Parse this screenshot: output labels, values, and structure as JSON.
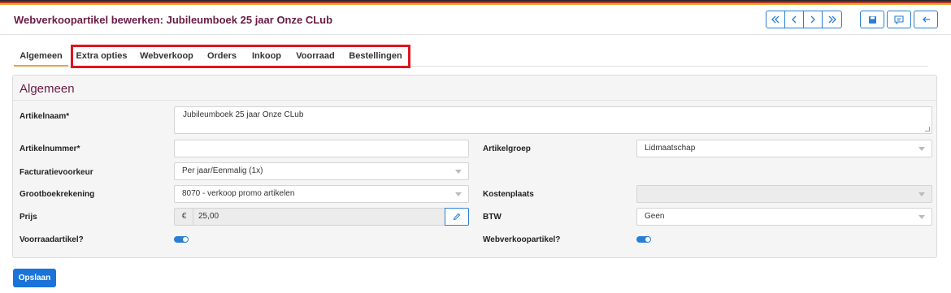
{
  "header": {
    "title": "Webverkoopartikel bewerken: Jubileumboek 25 jaar Onze CLub"
  },
  "tabs": [
    {
      "label": "Algemeen",
      "active": true
    },
    {
      "label": "Extra opties"
    },
    {
      "label": "Webverkoop"
    },
    {
      "label": "Orders"
    },
    {
      "label": "Inkoop"
    },
    {
      "label": "Voorraad"
    },
    {
      "label": "Bestellingen"
    }
  ],
  "panel": {
    "title": "Algemeen",
    "fields": {
      "artikelnaam": {
        "label": "Artikelnaam*",
        "value": "Jubileumboek 25 jaar Onze CLub"
      },
      "artikelnummer": {
        "label": "Artikelnummer*",
        "value": ""
      },
      "artikelgroep": {
        "label": "Artikelgroep",
        "value": "Lidmaatschap"
      },
      "facturatievoorkeur": {
        "label": "Facturatievoorkeur",
        "value": "Per jaar/Eenmalig (1x)"
      },
      "grootboekrekening": {
        "label": "Grootboekrekening",
        "value": "8070 - verkoop promo artikelen"
      },
      "kostenplaats": {
        "label": "Kostenplaats",
        "value": ""
      },
      "prijs": {
        "label": "Prijs",
        "currency": "€",
        "value": "25,00"
      },
      "btw": {
        "label": "BTW",
        "value": "Geen"
      },
      "voorraadartikel": {
        "label": "Voorraadartikel?",
        "on": true
      },
      "webverkoopartikel": {
        "label": "Webverkoopartikel?",
        "on": true
      }
    }
  },
  "footer": {
    "save_label": "Opslaan"
  },
  "colors": {
    "accent": "#2a7fd4",
    "title": "#6b1b44",
    "tab_active": "#e8a23a",
    "highlight": "#e0141e"
  }
}
